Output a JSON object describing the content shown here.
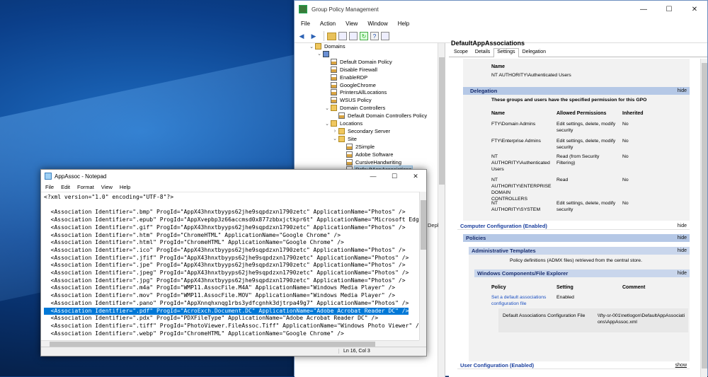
{
  "gpm": {
    "title": "Group Policy Management",
    "menu": [
      "File",
      "Action",
      "View",
      "Window",
      "Help"
    ],
    "winbtns": {
      "min": "—",
      "max": "☐",
      "close": "✕"
    },
    "tree": [
      {
        "label": "Domains",
        "depth": 0,
        "exp": "⌄",
        "icon": "ou"
      },
      {
        "label": "",
        "depth": 1,
        "exp": "⌄",
        "icon": "domain"
      },
      {
        "label": "Default Domain Policy",
        "depth": 2,
        "exp": "",
        "icon": "link"
      },
      {
        "label": "Disable Firewall",
        "depth": 2,
        "exp": "",
        "icon": "link"
      },
      {
        "label": "EnableRDP",
        "depth": 2,
        "exp": "",
        "icon": "link"
      },
      {
        "label": "GoogleChrome",
        "depth": 2,
        "exp": "",
        "icon": "link"
      },
      {
        "label": "PrintersAllLocations",
        "depth": 2,
        "exp": "",
        "icon": "link"
      },
      {
        "label": "WSUS Policy",
        "depth": 2,
        "exp": "",
        "icon": "link"
      },
      {
        "label": "Domain Controllers",
        "depth": 2,
        "exp": "⌄",
        "icon": "ou"
      },
      {
        "label": "Default Domain Controllers Policy",
        "depth": 3,
        "exp": "",
        "icon": "link"
      },
      {
        "label": "Locations",
        "depth": 2,
        "exp": "⌄",
        "icon": "ou"
      },
      {
        "label": "Secondary Server",
        "depth": 3,
        "exp": "›",
        "icon": "ou"
      },
      {
        "label": "Site",
        "depth": 3,
        "exp": "⌄",
        "icon": "ou"
      },
      {
        "label": "2Simple",
        "depth": 4,
        "exp": "",
        "icon": "link"
      },
      {
        "label": "Adobe Software",
        "depth": 4,
        "exp": "",
        "icon": "link"
      },
      {
        "label": "CursiveHandwriting",
        "depth": 4,
        "exp": "",
        "icon": "link"
      },
      {
        "label": "DefaultAppAssociations",
        "depth": 4,
        "exp": "",
        "icon": "link",
        "selected": true
      }
    ],
    "depl_fragment": "Depl",
    "right": {
      "title": "DefaultAppAssociations",
      "tabs": [
        "Scope",
        "Details",
        "Settings",
        "Delegation"
      ],
      "active_tab": "Settings",
      "name_header": "Name",
      "name_value": "NT AUTHORITY\\Authenticated Users",
      "delegation": {
        "label": "Delegation",
        "hide": "hide",
        "intro": "These groups and users have the specified permission for this GPO",
        "headers": [
          "Name",
          "Allowed Permissions",
          "Inherited"
        ],
        "rows": [
          {
            "name": "FTY\\Domain Admins",
            "perm": "Edit settings, delete, modify security",
            "inh": "No"
          },
          {
            "name": "FTY\\Enterprise Admins",
            "perm": "Edit settings, delete, modify security",
            "inh": "No"
          },
          {
            "name": "NT AUTHORITY\\Authenticated Users",
            "perm": "Read (from Security Filtering)",
            "inh": "No"
          },
          {
            "name": "NT AUTHORITY\\ENTERPRISE DOMAIN CONTROLLERS",
            "perm": "Read",
            "inh": "No"
          },
          {
            "name": "NT AUTHORITY\\SYSTEM",
            "perm": "Edit settings, delete, modify security",
            "inh": "No"
          }
        ]
      },
      "computer_config": "Computer Configuration (Enabled)",
      "policies": "Policies",
      "admin_templates": "Administrative Templates",
      "admin_note": "Policy definitions (ADMX files) retrieved from the central store.",
      "wcfe": "Windows Components/File Explorer",
      "policy_headers": [
        "Policy",
        "Setting",
        "Comment"
      ],
      "policy_name": "Set a default associations configuration file",
      "policy_setting": "Enabled",
      "policy_detail_label": "Default Associations Configuration File",
      "policy_detail_value": "\\\\fty-sr-001\\netlogon\\DefaultAppAssociations\\AppAssoc.xml",
      "user_config": "User Configuration (Enabled)",
      "hide": "hide",
      "show": "show"
    }
  },
  "notepad": {
    "title": "AppAssoc - Notepad",
    "menu": [
      "File",
      "Edit",
      "Format",
      "View",
      "Help"
    ],
    "winbtns": {
      "min": "—",
      "max": "☐",
      "close": "✕"
    },
    "lines": [
      "<?xml version=\"1.0\" encoding=\"UTF-8\"?>",
      "",
      "  <Association Identifier=\".bmp\" ProgId=\"AppX43hnxtbyyps62jhe9sqpdzxn1790zetc\" ApplicationName=\"Photos\" />",
      "  <Association Identifier=\".epub\" ProgId=\"AppXvepbp3z66accmsd0x877zbbxjctkpr6t\" ApplicationName=\"Microsoft Edg",
      "  <Association Identifier=\".gif\" ProgId=\"AppX43hnxtbyyps62jhe9sqpdzxn1790zetc\" ApplicationName=\"Photos\" />",
      "  <Association Identifier=\".htm\" ProgId=\"ChromeHTML\" ApplicationName=\"Google Chrome\" />",
      "  <Association Identifier=\".html\" ProgId=\"ChromeHTML\" ApplicationName=\"Google Chrome\" />",
      "  <Association Identifier=\".ico\" ProgId=\"AppX43hnxtbyyps62jhe9sqpdzxn1790zetc\" ApplicationName=\"Photos\" />",
      "  <Association Identifier=\".jfif\" ProgId=\"AppX43hnxtbyyps62jhe9sqpdzxn1790zetc\" ApplicationName=\"Photos\" />",
      "  <Association Identifier=\".jpe\" ProgId=\"AppX43hnxtbyyps62jhe9sqpdzxn1790zetc\" ApplicationName=\"Photos\" />",
      "  <Association Identifier=\".jpeg\" ProgId=\"AppX43hnxtbyyps62jhe9sqpdzxn1790zetc\" ApplicationName=\"Photos\" />",
      "  <Association Identifier=\".jpg\" ProgId=\"AppX43hnxtbyyps62jhe9sqpdzxn1790zetc\" ApplicationName=\"Photos\" />",
      "  <Association Identifier=\".m4a\" ProgId=\"WMP11.AssocFile.M4A\" ApplicationName=\"Windows Media Player\" />",
      "  <Association Identifier=\".mov\" ProgId=\"WMP11.AssocFile.MOV\" ApplicationName=\"Windows Media Player\" />",
      "  <Association Identifier=\".pano\" ProgId=\"AppXnnqhxnqg1rbs3ydfcgnhk3djtrpa49g7\" ApplicationName=\"Photos\" />",
      "  <Association Identifier=\".pdf\" ProgId=\"AcroExch.Document.DC\" ApplicationName=\"Adobe Acrobat Reader DC\" />",
      "  <Association Identifier=\".pdx\" ProgId=\"PDXFileType\" ApplicationName=\"Adobe Acrobat Reader DC\" />",
      "  <Association Identifier=\".tiff\" ProgId=\"PhotoViewer.FileAssoc.Tiff\" ApplicationName=\"Windows Photo Viewer\" /",
      "  <Association Identifier=\".webp\" ProgId=\"ChromeHTML\" ApplicationName=\"Google Chrome\" />"
    ],
    "selected_line": 15,
    "status_pos": "Ln 16, Col 3"
  }
}
